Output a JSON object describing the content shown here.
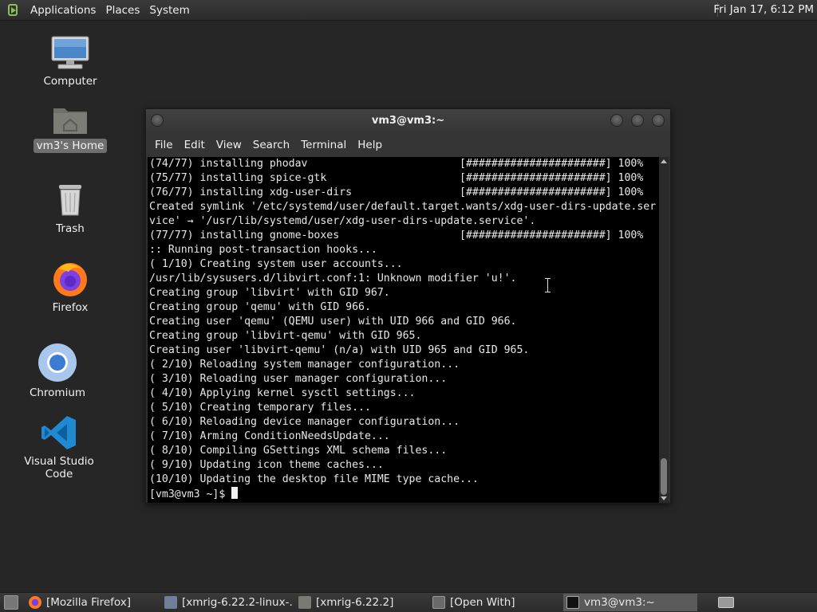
{
  "top_panel": {
    "menus": [
      "Applications",
      "Places",
      "System"
    ],
    "clock": "Fri Jan 17,  6:12 PM"
  },
  "desktop_icons": [
    {
      "label": "Computer",
      "icon": "computer-icon"
    },
    {
      "label": "vm3's Home",
      "icon": "home-folder-icon"
    },
    {
      "label": "Trash",
      "icon": "trash-icon"
    },
    {
      "label": "Firefox",
      "icon": "firefox-icon"
    },
    {
      "label": "Chromium",
      "icon": "chromium-icon"
    },
    {
      "label": "Visual Studio Code",
      "icon": "vscode-icon"
    }
  ],
  "terminal": {
    "title": "vm3@vm3:~",
    "menu": [
      "File",
      "Edit",
      "View",
      "Search",
      "Terminal",
      "Help"
    ],
    "lines": [
      "(74/77) installing phodav                        [######################] 100%",
      "(75/77) installing spice-gtk                     [######################] 100%",
      "(76/77) installing xdg-user-dirs                 [######################] 100%",
      "Created symlink '/etc/systemd/user/default.target.wants/xdg-user-dirs-update.ser",
      "vice' → '/usr/lib/systemd/user/xdg-user-dirs-update.service'.",
      "(77/77) installing gnome-boxes                   [######################] 100%",
      ":: Running post-transaction hooks...",
      "( 1/10) Creating system user accounts...",
      "/usr/lib/sysusers.d/libvirt.conf:1: Unknown modifier 'u!'.",
      "Creating group 'libvirt' with GID 967.",
      "Creating group 'qemu' with GID 966.",
      "Creating user 'qemu' (QEMU user) with UID 966 and GID 966.",
      "Creating group 'libvirt-qemu' with GID 965.",
      "Creating user 'libvirt-qemu' (n/a) with UID 965 and GID 965.",
      "( 2/10) Reloading system manager configuration...",
      "( 3/10) Reloading user manager configuration...",
      "( 4/10) Applying kernel sysctl settings...",
      "( 5/10) Creating temporary files...",
      "( 6/10) Reloading device manager configuration...",
      "( 7/10) Arming ConditionNeedsUpdate...",
      "( 8/10) Compiling GSettings XML schema files...",
      "( 9/10) Updating icon theme caches...",
      "(10/10) Updating the desktop file MIME type cache..."
    ],
    "prompt": "[vm3@vm3 ~]$ "
  },
  "taskbar": [
    {
      "label": "[Mozilla Firefox]",
      "icon": "firefox-icon",
      "active": false
    },
    {
      "label": "[xmrig-6.22.2-linux-…",
      "icon": "file-manager-icon",
      "active": false
    },
    {
      "label": "[xmrig-6.22.2]",
      "icon": "folder-icon",
      "active": false
    },
    {
      "label": "[Open With]",
      "icon": "dialog-icon",
      "active": false
    },
    {
      "label": "vm3@vm3:~",
      "icon": "terminal-icon",
      "active": true
    }
  ],
  "colors": {
    "desktop_bg": "#262626",
    "panel_bg": "#333333",
    "terminal_bg": "#000000",
    "terminal_fg": "#e8e8e8"
  }
}
